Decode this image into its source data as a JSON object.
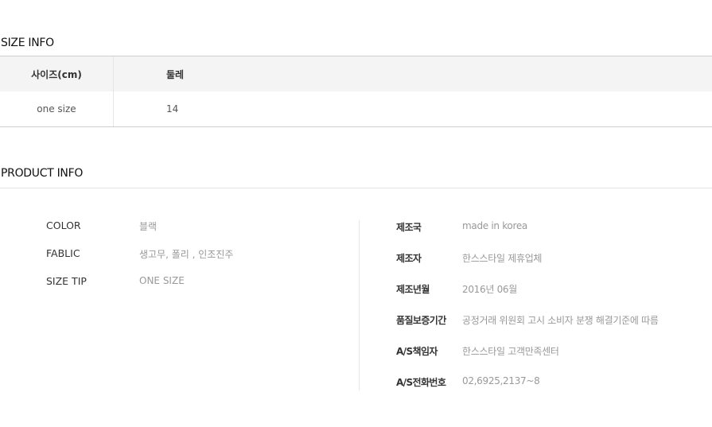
{
  "size_info": {
    "title": "SIZE INFO",
    "headers": [
      "사이즈(cm)",
      "둘레"
    ],
    "rows": [
      [
        "one size",
        "14"
      ]
    ]
  },
  "product_info": {
    "title": "PRODUCT INFO",
    "left": [
      {
        "label": "COLOR",
        "value": "블랙"
      },
      {
        "label": "FABLIC",
        "value": "생고무, 폴리 , 인조진주"
      },
      {
        "label": "SIZE TIP",
        "value": "ONE SIZE"
      }
    ],
    "right": [
      {
        "label": "제조국",
        "value": "made in korea"
      },
      {
        "label": "제조자",
        "value": "한스스타일 제휴업체"
      },
      {
        "label": "제조년월",
        "value": "2016년 06월"
      },
      {
        "label": "품질보증기간",
        "value": "공정거래 위원회 고시 소비자 분쟁 해결기준에 따름"
      },
      {
        "label": "A/S책임자",
        "value": "한스스타일 고객만족센터"
      },
      {
        "label": "A/S전화번호",
        "value": "02,6925,2137~8"
      }
    ]
  }
}
